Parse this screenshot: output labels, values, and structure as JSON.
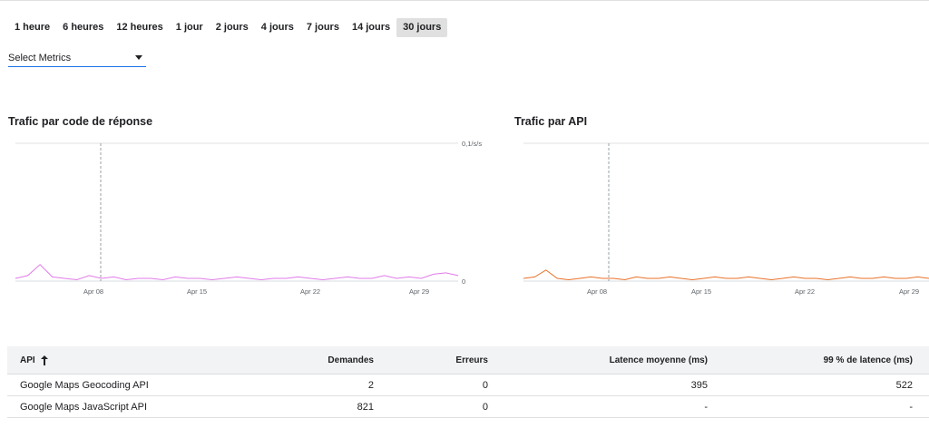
{
  "time_range": {
    "options": [
      "1 heure",
      "6 heures",
      "12 heures",
      "1 jour",
      "2 jours",
      "4 jours",
      "7 jours",
      "14 jours",
      "30 jours"
    ],
    "selected": "30 jours"
  },
  "metrics_select": {
    "label": "Select Metrics",
    "icon": "caret-down-icon"
  },
  "chart_data": [
    {
      "type": "line",
      "title": "Trafic par code de réponse",
      "x_ticks": [
        "Apr 08",
        "Apr 15",
        "Apr 22",
        "Apr 29"
      ],
      "y_ticks": [
        "0",
        "0,1/s/s"
      ],
      "ylim": [
        0,
        0.1
      ],
      "grid": true,
      "series": [
        {
          "color": "#e07be8",
          "values": [
            0.002,
            0.004,
            0.012,
            0.003,
            0.002,
            0.001,
            0.004,
            0.002,
            0.003,
            0.001,
            0.002,
            0.002,
            0.001,
            0.003,
            0.002,
            0.002,
            0.001,
            0.002,
            0.003,
            0.002,
            0.001,
            0.002,
            0.002,
            0.003,
            0.002,
            0.001,
            0.002,
            0.003,
            0.002,
            0.002,
            0.004,
            0.002,
            0.003,
            0.002,
            0.005,
            0.006,
            0.004
          ]
        }
      ]
    },
    {
      "type": "line",
      "title": "Trafic par API",
      "x_ticks": [
        "Apr 08",
        "Apr 15",
        "Apr 22",
        "Apr 29"
      ],
      "grid": true,
      "series": [
        {
          "color": "#e8712a",
          "values": [
            0.002,
            0.003,
            0.008,
            0.002,
            0.001,
            0.002,
            0.003,
            0.002,
            0.002,
            0.001,
            0.003,
            0.002,
            0.002,
            0.003,
            0.002,
            0.001,
            0.002,
            0.003,
            0.002,
            0.002,
            0.003,
            0.002,
            0.001,
            0.002,
            0.003,
            0.002,
            0.002,
            0.001,
            0.002,
            0.003,
            0.002,
            0.002,
            0.003,
            0.002,
            0.002,
            0.003,
            0.002
          ]
        }
      ]
    }
  ],
  "table": {
    "headers": {
      "api": "API",
      "requests": "Demandes",
      "errors": "Erreurs",
      "latency": "Latence moyenne (ms)",
      "p99": "99 % de latence (ms)"
    },
    "sort_icon": "arrow-up-icon",
    "rows": [
      {
        "api": "Google Maps Geocoding API",
        "requests": "2",
        "errors": "0",
        "latency": "395",
        "p99": "522"
      },
      {
        "api": "Google Maps JavaScript API",
        "requests": "821",
        "errors": "0",
        "latency": "-",
        "p99": "-"
      }
    ]
  }
}
